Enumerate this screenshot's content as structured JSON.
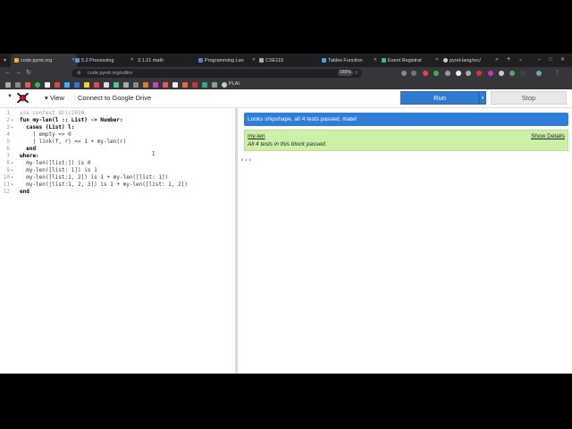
{
  "browser": {
    "tabs": [
      {
        "label": "code.pyret.org",
        "color": "#f5b324",
        "active": true
      },
      {
        "label": "5.2 Processing",
        "color": "#6a8fd6"
      },
      {
        "label": "3.1.21 math",
        "color": "#cccccc"
      },
      {
        "label": "Programming Lan",
        "color": "#5b7fd9"
      },
      {
        "label": "CSE115",
        "color": "#cccccc"
      },
      {
        "label": "Tables Function",
        "color": "#3aa2ff"
      },
      {
        "label": "Event Registrat",
        "color": "#33c36b"
      },
      {
        "label": "pyret-lang/src/",
        "color": "#cccccc"
      }
    ],
    "url": "code.pyret.org/editor",
    "zoom": "150%",
    "bookmark_label": "PLAI"
  },
  "toolbar": {
    "view_label": "▾ View",
    "drive_label": "Connect to Google Drive",
    "run_label": "Run",
    "stop_label": "Stop"
  },
  "editor": {
    "lines": [
      "use context dcic2024",
      "fun my-len(l :: List) -> Number:",
      "  cases (List) l:",
      "    | empty => 0",
      "    | link(f, r) => 1 + my-len(r)",
      "  end",
      "where:",
      "  my-len([list:]) is 0",
      "  my-len([list: 1]) is 1",
      "  my-len([list:1, 2]) is 1 + my-len([list: 1])",
      "  my-len([list:1, 2, 3]) is 1 + my-len([list: 1, 2])",
      "end"
    ]
  },
  "interactions": {
    "banner": "Looks shipshape, all 4 tests passed, mate!",
    "block_name": "my-len",
    "show_details": "Show Details",
    "block_message": "All 4 tests in this block passed.",
    "prompt": "›››"
  }
}
